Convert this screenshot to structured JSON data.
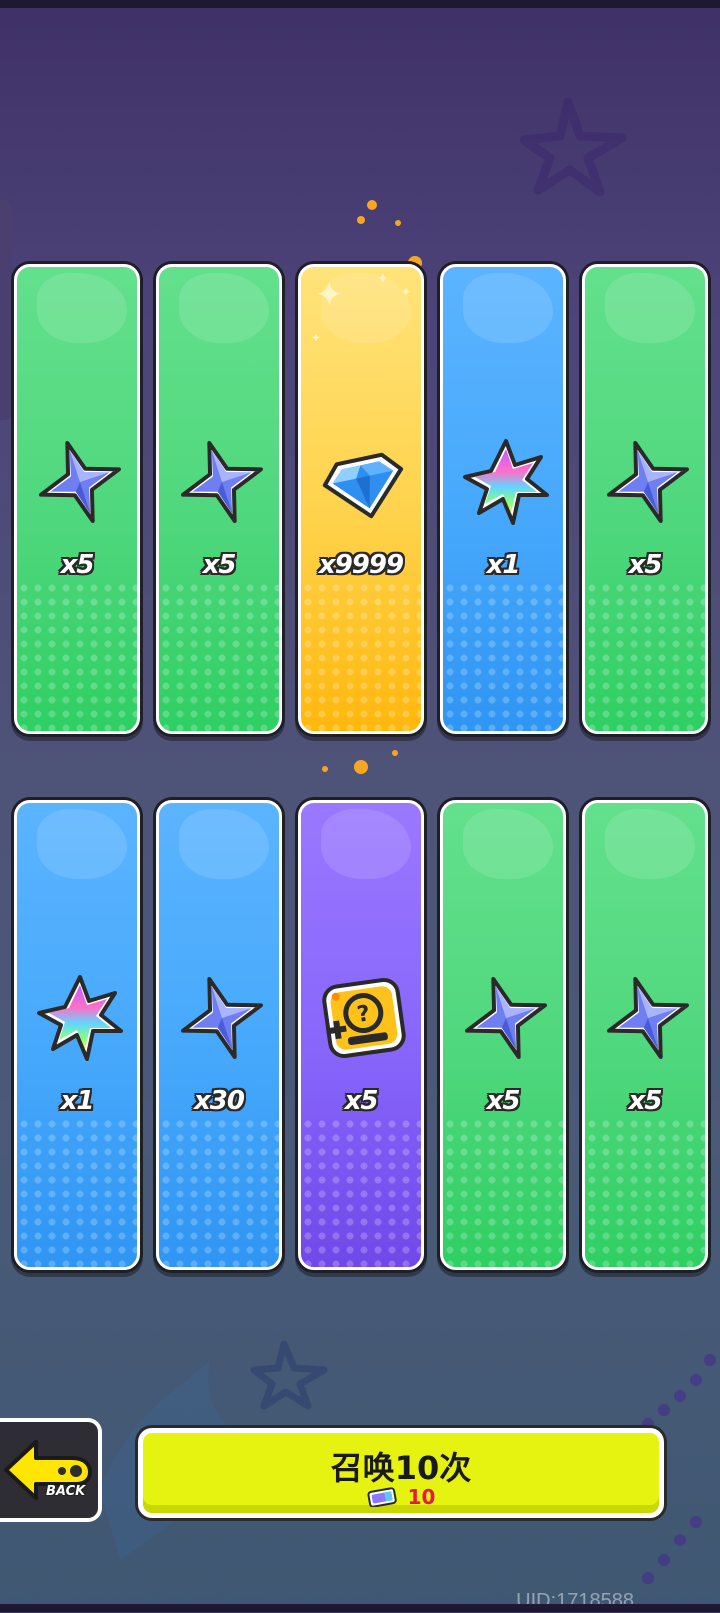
{
  "cards": [
    {
      "color": "green",
      "icon": "blue-star-crystal-icon",
      "quantity": "x5"
    },
    {
      "color": "green",
      "icon": "blue-star-crystal-icon",
      "quantity": "x5"
    },
    {
      "color": "yellow",
      "icon": "blue-diamond-gem-icon",
      "quantity": "x9999"
    },
    {
      "color": "blue",
      "icon": "rainbow-leaf-crystal-icon",
      "quantity": "x1"
    },
    {
      "color": "green",
      "icon": "blue-star-crystal-icon",
      "quantity": "x5"
    },
    {
      "color": "blue",
      "icon": "rainbow-leaf-crystal-icon",
      "quantity": "x1"
    },
    {
      "color": "blue",
      "icon": "blue-star-crystal-icon",
      "quantity": "x30"
    },
    {
      "color": "purple",
      "icon": "mystery-badge-icon",
      "quantity": "x5"
    },
    {
      "color": "green",
      "icon": "blue-star-crystal-icon",
      "quantity": "x5"
    },
    {
      "color": "green",
      "icon": "blue-star-crystal-icon",
      "quantity": "x5"
    }
  ],
  "back_button": {
    "label": "BACK",
    "icon": "back-arrow-icon"
  },
  "summon_button": {
    "label": "召唤10次",
    "cost_icon": "ticket-icon",
    "cost": "10"
  },
  "uid_label": "UID:1718588",
  "colors": {
    "green": "#4fd77d",
    "blue": "#46a8fb",
    "yellow": "#ffd24a",
    "purple": "#8765fb",
    "summon_button": "#e6f311",
    "cost_text": "#e8174a"
  }
}
